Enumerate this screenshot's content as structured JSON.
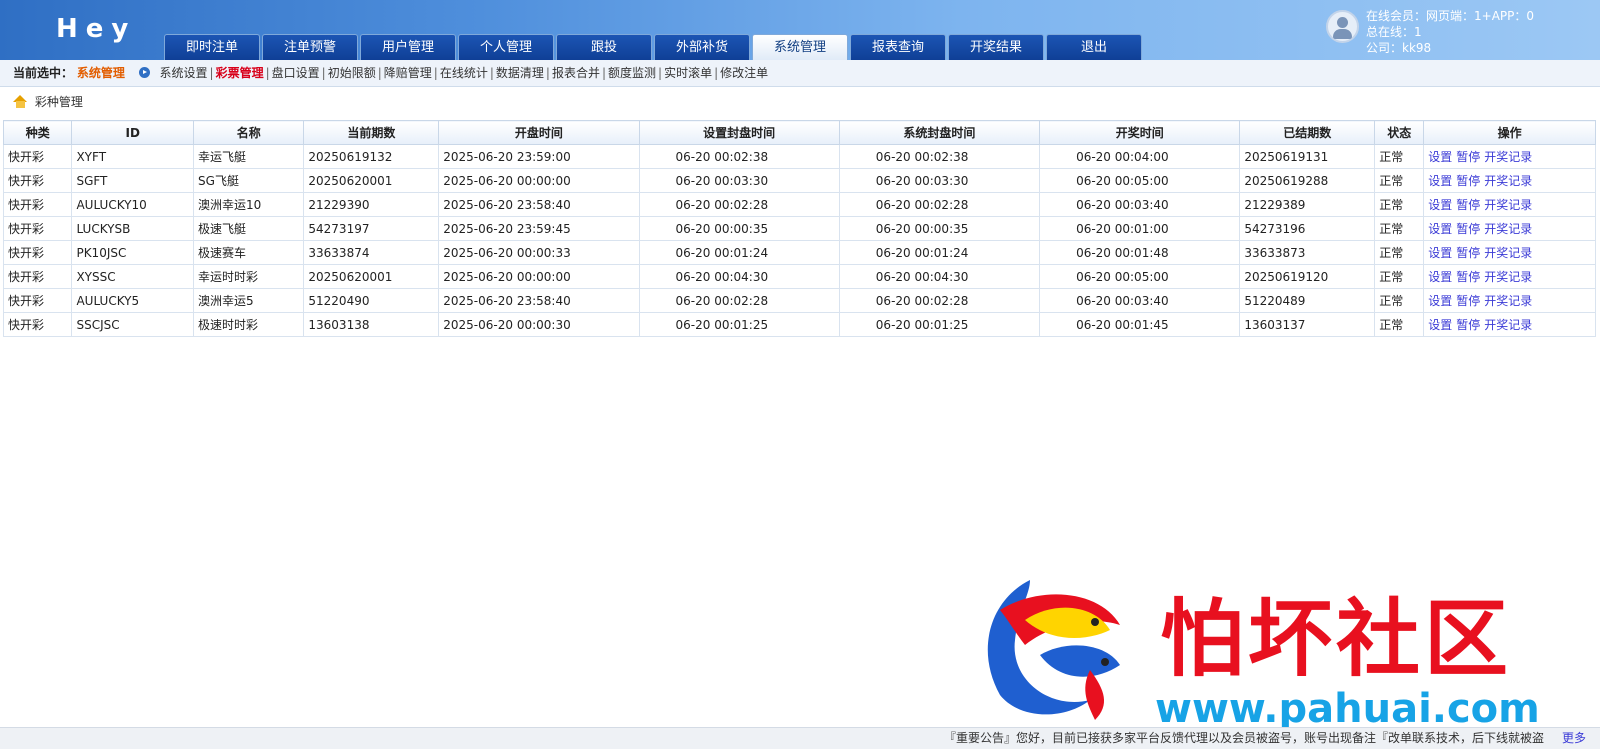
{
  "header": {
    "logo": "Hey",
    "nav": [
      "即时注单",
      "注单预警",
      "用户管理",
      "个人管理",
      "跟投",
      "外部补货",
      "系统管理",
      "报表查询",
      "开奖结果",
      "退出"
    ],
    "active_nav": "系统管理",
    "online": {
      "line1": "在线会员：网页端：1+APP：0",
      "line2": "总在线：1",
      "line3": "公司：kk98"
    }
  },
  "submenu": {
    "label": "当前选中：",
    "current": "系统管理",
    "items": [
      "系统设置",
      "彩票管理",
      "盘口设置",
      "初始限额",
      "降赔管理",
      "在线统计",
      "数据清理",
      "报表合并",
      "额度监测",
      "实时滚单",
      "修改注单"
    ],
    "selected": "彩票管理"
  },
  "breadcrumb": "彩种管理",
  "table": {
    "headers": [
      "种类",
      "ID",
      "名称",
      "当前期数",
      "开盘时间",
      "设置封盘时间",
      "系统封盘时间",
      "开奖时间",
      "已结期数",
      "状态",
      "操作"
    ],
    "actions": [
      "设置",
      "暂停",
      "开奖记录"
    ],
    "rows": [
      [
        "快开彩",
        "XYFT",
        "幸运飞艇",
        "20250619132",
        "2025-06-20 23:59:00",
        "06-20 00:02:38",
        "06-20 00:02:38",
        "06-20 00:04:00",
        "20250619131",
        "正常"
      ],
      [
        "快开彩",
        "SGFT",
        "SG飞艇",
        "20250620001",
        "2025-06-20 00:00:00",
        "06-20 00:03:30",
        "06-20 00:03:30",
        "06-20 00:05:00",
        "20250619288",
        "正常"
      ],
      [
        "快开彩",
        "AULUCKY10",
        "澳洲幸运10",
        "21229390",
        "2025-06-20 23:58:40",
        "06-20 00:02:28",
        "06-20 00:02:28",
        "06-20 00:03:40",
        "21229389",
        "正常"
      ],
      [
        "快开彩",
        "LUCKYSB",
        "极速飞艇",
        "54273197",
        "2025-06-20 23:59:45",
        "06-20 00:00:35",
        "06-20 00:00:35",
        "06-20 00:01:00",
        "54273196",
        "正常"
      ],
      [
        "快开彩",
        "PK10JSC",
        "极速赛车",
        "33633874",
        "2025-06-20 00:00:33",
        "06-20 00:01:24",
        "06-20 00:01:24",
        "06-20 00:01:48",
        "33633873",
        "正常"
      ],
      [
        "快开彩",
        "XYSSC",
        "幸运时时彩",
        "20250620001",
        "2025-06-20 00:00:00",
        "06-20 00:04:30",
        "06-20 00:04:30",
        "06-20 00:05:00",
        "20250619120",
        "正常"
      ],
      [
        "快开彩",
        "AULUCKY5",
        "澳洲幸运5",
        "51220490",
        "2025-06-20 23:58:40",
        "06-20 00:02:28",
        "06-20 00:02:28",
        "06-20 00:03:40",
        "51220489",
        "正常"
      ],
      [
        "快开彩",
        "SSCJSC",
        "极速时时彩",
        "13603138",
        "2025-06-20 00:00:30",
        "06-20 00:01:25",
        "06-20 00:01:25",
        "06-20 00:01:45",
        "13603137",
        "正常"
      ]
    ]
  },
  "watermark": {
    "title": "怕坏社区",
    "url": "www.pahuai.com"
  },
  "footer": {
    "notice": "『重要公告』您好，目前已接获多家平台反馈代理以及会员被盗号，账号出现备注『改单联系技术，后下线就被盗",
    "more": "更多"
  },
  "colors": {
    "header_blue": "#2f6fc4",
    "tab_blue": "#0f3f96",
    "highlight_orange": "#e25d00",
    "highlight_red": "#d8001a",
    "link": "#3b3bd6"
  }
}
